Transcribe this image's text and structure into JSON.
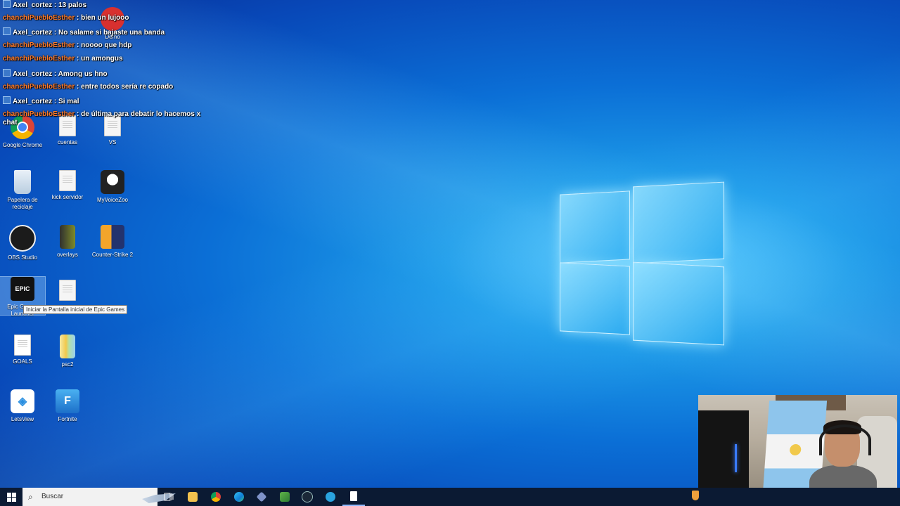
{
  "chat": [
    {
      "user": "Axel_cortez",
      "text": " : 13 palos",
      "badge": true
    },
    {
      "user": "chanchiPuebloEsther",
      "text": " : bien un lujooo",
      "badge": false
    },
    {
      "user": "Axel_cortez",
      "text": " : No salame si bajaste una banda",
      "badge": true
    },
    {
      "user": "chanchiPuebloEsther",
      "text": " : noooo que hdp",
      "badge": false
    },
    {
      "user": "chanchiPuebloEsther",
      "text": " : un amongus",
      "badge": false
    },
    {
      "user": "Axel_cortez",
      "text": " : Among us hno",
      "badge": true
    },
    {
      "user": "chanchiPuebloEsther",
      "text": " : entre todos sería re copado",
      "badge": false
    },
    {
      "user": "Axel_cortez",
      "text": " : Si mal",
      "badge": true
    },
    {
      "user": "chanchiPuebloEsther",
      "text": " : de última para debatir lo hacemos x chat",
      "badge": false
    }
  ],
  "desktop_icons": {
    "demo": "Demo",
    "chrome": "Google Chrome",
    "cuentas": "cuentas",
    "vs": "VS",
    "papelera": "Papelera de reciclaje",
    "kick": "kick servidor",
    "myvoicezoo": "MyVoiceZoo",
    "obs": "OBS Studio",
    "overlays": "overlays",
    "cs2": "Counter-Strike 2",
    "epic": "Epic Games Launcher",
    "goals": "GOALS",
    "psc2": "psc2",
    "letsview": "LetsView",
    "fortnite": "Fortnite"
  },
  "icon_glyphs": {
    "epic": "EPIC",
    "fortnite": "F"
  },
  "tooltip": "Iniciar la Pantalla inicial de Epic Games",
  "taskbar": {
    "search_placeholder": "Buscar"
  },
  "colors": {
    "chat_user": "#ff7b2a",
    "taskbar_bg": "#0b1a33"
  },
  "icons": [
    "windows-start-icon",
    "search-icon",
    "task-view-icon",
    "file-explorer-icon",
    "chrome-icon",
    "edge-icon",
    "app-icon",
    "minecraft-icon",
    "steam-icon",
    "telegram-icon",
    "pdf-icon"
  ]
}
